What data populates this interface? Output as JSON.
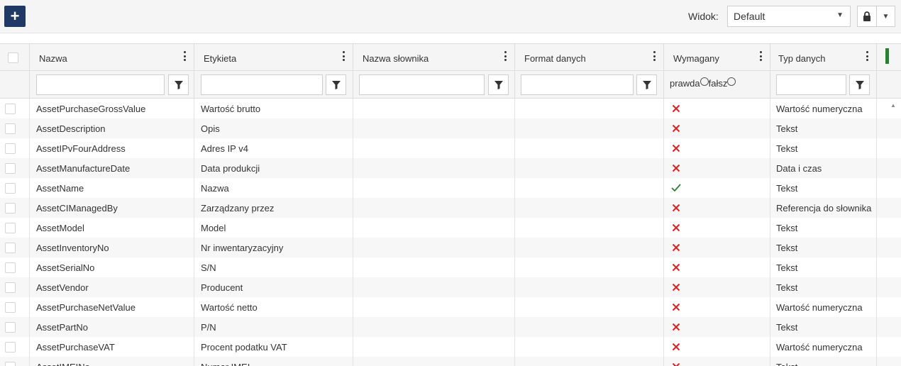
{
  "toolbar": {
    "add_label": "+",
    "view_label": "Widok:",
    "view_value": "Default"
  },
  "columns": {
    "name": "Nazwa",
    "label": "Etykieta",
    "dictionary": "Nazwa słownika",
    "format": "Format danych",
    "required": "Wymagany",
    "type": "Typ danych"
  },
  "filters": {
    "required_true": "prawda",
    "required_false": "fałsz"
  },
  "rows": [
    {
      "name": "AssetPurchaseGrossValue",
      "label": "Wartość brutto",
      "required": false,
      "type": "Wartość numeryczna"
    },
    {
      "name": "AssetDescription",
      "label": "Opis",
      "required": false,
      "type": "Tekst"
    },
    {
      "name": "AssetIPvFourAddress",
      "label": "Adres IP v4",
      "required": false,
      "type": "Tekst"
    },
    {
      "name": "AssetManufactureDate",
      "label": "Data produkcji",
      "required": false,
      "type": "Data i czas"
    },
    {
      "name": "AssetName",
      "label": "Nazwa",
      "required": true,
      "type": "Tekst"
    },
    {
      "name": "AssetCIManagedBy",
      "label": "Zarządzany przez",
      "required": false,
      "type": "Referencja do słownika"
    },
    {
      "name": "AssetModel",
      "label": "Model",
      "required": false,
      "type": "Tekst"
    },
    {
      "name": "AssetInventoryNo",
      "label": "Nr inwentaryzacyjny",
      "required": false,
      "type": "Tekst"
    },
    {
      "name": "AssetSerialNo",
      "label": "S/N",
      "required": false,
      "type": "Tekst"
    },
    {
      "name": "AssetVendor",
      "label": "Producent",
      "required": false,
      "type": "Tekst"
    },
    {
      "name": "AssetPurchaseNetValue",
      "label": "Wartość netto",
      "required": false,
      "type": "Wartość numeryczna"
    },
    {
      "name": "AssetPartNo",
      "label": "P/N",
      "required": false,
      "type": "Tekst"
    },
    {
      "name": "AssetPurchaseVAT",
      "label": "Procent podatku VAT",
      "required": false,
      "type": "Wartość numeryczna"
    },
    {
      "name": "AssetIMEINo",
      "label": "Numer IMEI",
      "required": false,
      "type": "Tekst"
    }
  ],
  "colors": {
    "add_button": "#1f3864",
    "cross": "#e02020",
    "check": "#2e7d32"
  }
}
